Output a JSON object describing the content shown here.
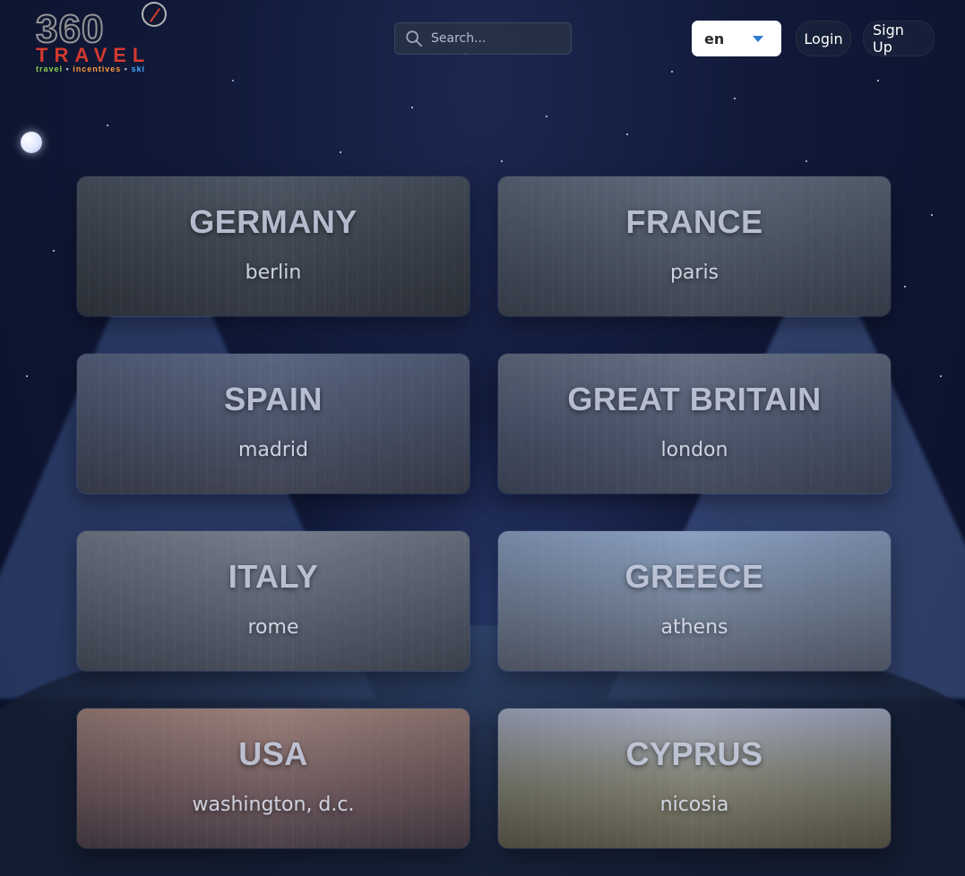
{
  "header": {
    "logo": {
      "number": "360",
      "word": "TRAVEL",
      "tagline": {
        "travel": "travel",
        "incentives": "incentives",
        "ski": "ski",
        "separator": "•"
      }
    },
    "search": {
      "placeholder": "Search...",
      "icon": "search-icon"
    },
    "language": {
      "selected": "en"
    },
    "nav": {
      "login_label": "Login",
      "signup_label": "Sign Up"
    }
  },
  "destinations": [
    {
      "country": "GERMANY",
      "city": "berlin"
    },
    {
      "country": "FRANCE",
      "city": "paris"
    },
    {
      "country": "SPAIN",
      "city": "madrid"
    },
    {
      "country": "GREAT BRITAIN",
      "city": "london"
    },
    {
      "country": "ITALY",
      "city": "rome"
    },
    {
      "country": "GREECE",
      "city": "athens"
    },
    {
      "country": "USA",
      "city": "washington, d.c."
    },
    {
      "country": "CYPRUS",
      "city": "nicosia"
    }
  ],
  "colors": {
    "logo_red": "#d33a2f",
    "tag_travel": "#8bd04c",
    "tag_incentives": "#ff9a3d",
    "tag_ski": "#44a4ff",
    "dropdown_caret": "#2d7bd1"
  },
  "icons": {
    "moon": "moon-icon",
    "compass": "compass-icon",
    "dropdown": "caret-down-icon"
  }
}
